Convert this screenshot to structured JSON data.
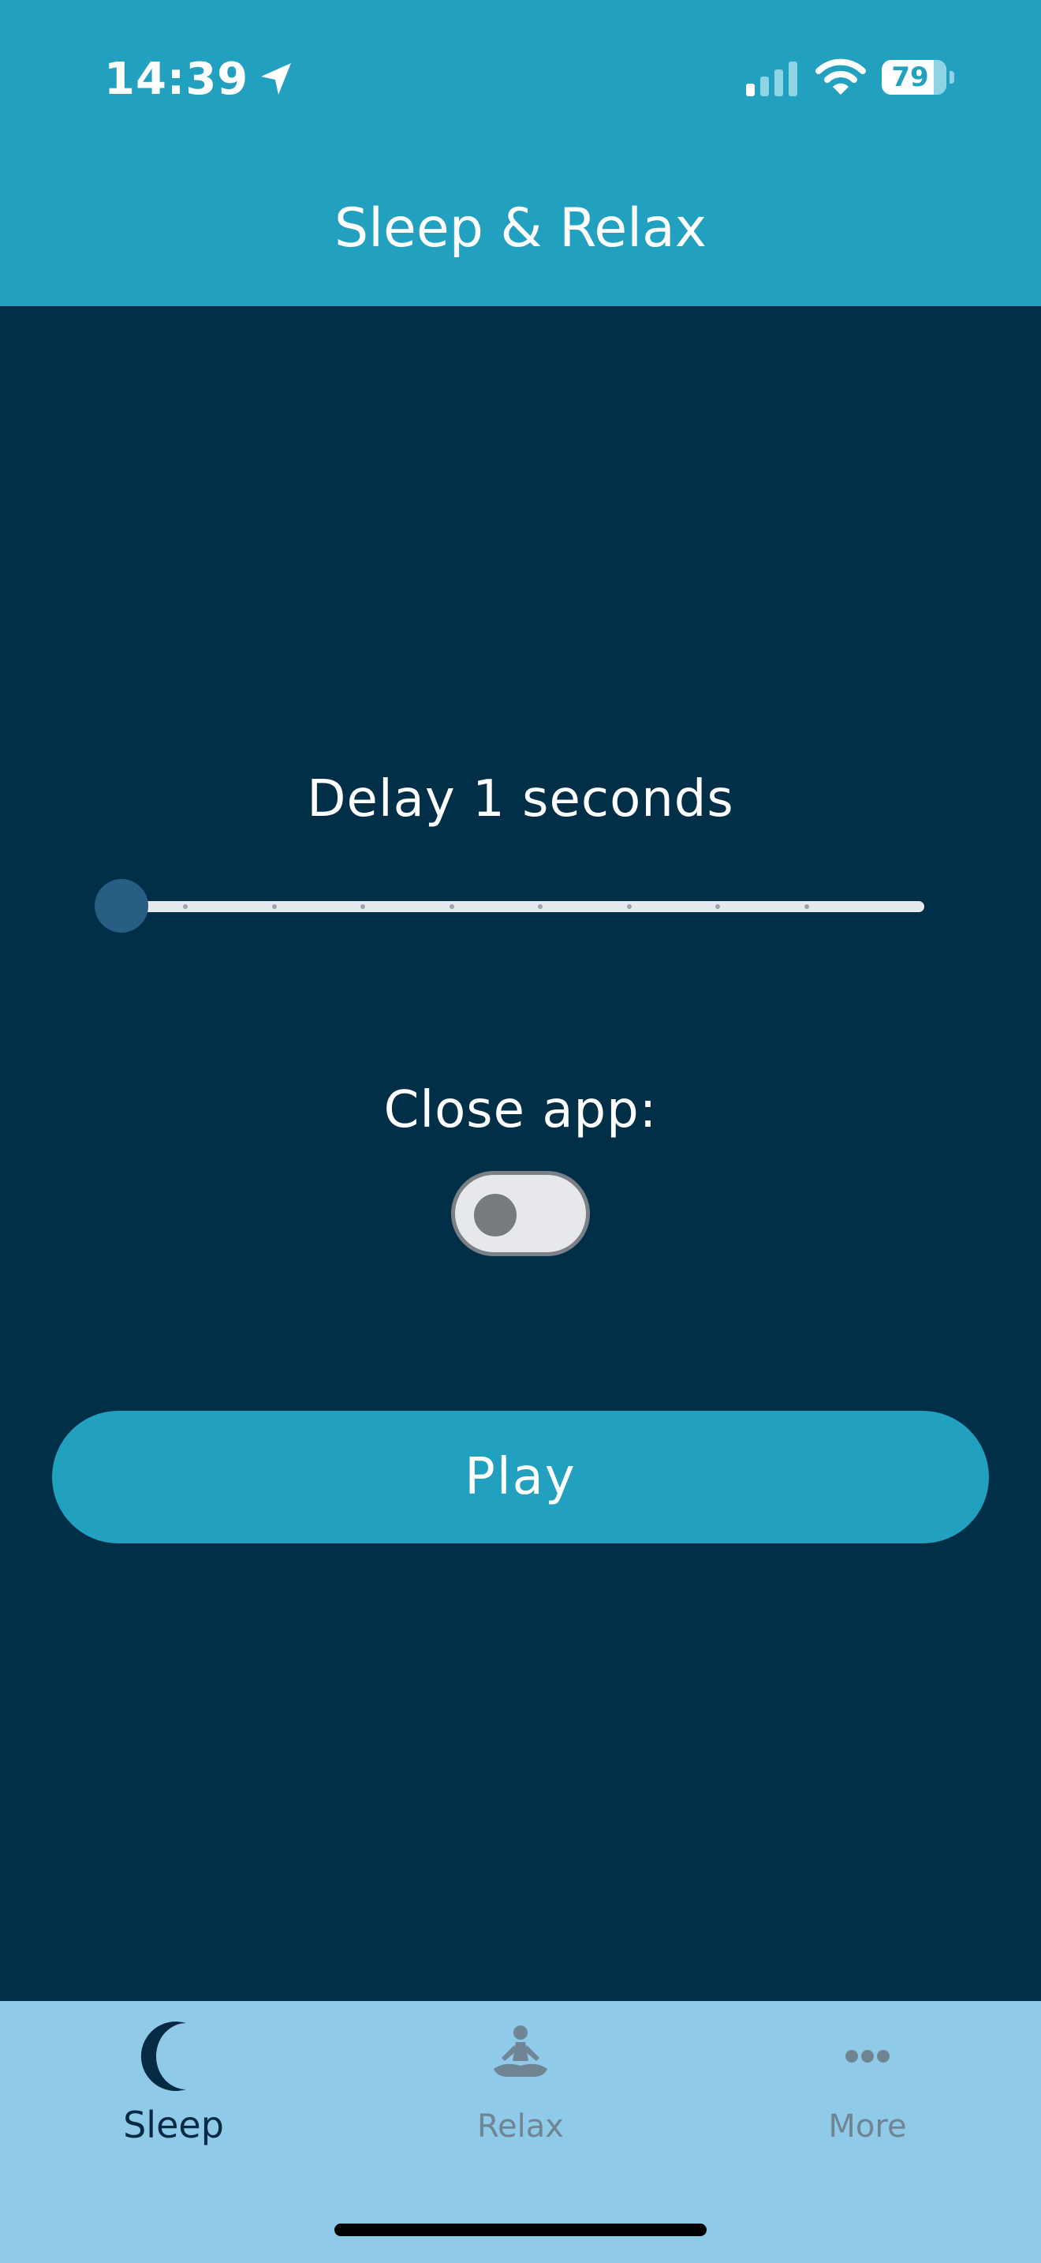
{
  "status_bar": {
    "time": "14:39",
    "battery_level": "79",
    "icons": [
      "location-arrow-icon",
      "cellular-signal-icon",
      "wifi-icon",
      "battery-icon"
    ]
  },
  "header": {
    "title": "Sleep & Relax"
  },
  "delay": {
    "label": "Delay 1 seconds",
    "slider_value": 1,
    "slider_steps": 10
  },
  "close_app": {
    "label": "Close app:",
    "enabled": false
  },
  "play_button": {
    "label": "Play"
  },
  "tabs": [
    {
      "label": "Sleep",
      "icon": "moon-icon",
      "active": true
    },
    {
      "label": "Relax",
      "icon": "meditation-icon",
      "active": false
    },
    {
      "label": "More",
      "icon": "more-dots-icon",
      "active": false
    }
  ],
  "colors": {
    "header": "#21a0bf",
    "background": "#012f47",
    "tab_bar": "#8fcbe8",
    "accent": "#21a0bf",
    "slider_thumb": "#275e84",
    "tab_active": "#052b44",
    "tab_inactive": "#6f8593"
  }
}
